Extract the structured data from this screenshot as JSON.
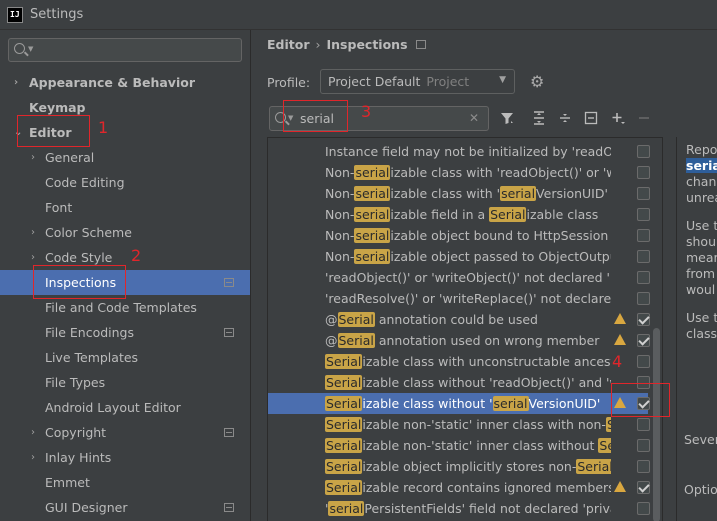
{
  "window": {
    "app_icon": "IJ",
    "title": "Settings"
  },
  "sidebar": {
    "search_placeholder": "",
    "items": [
      {
        "label": "Appearance & Behavior",
        "arrow": "›",
        "bold": true
      },
      {
        "label": "Keymap",
        "bold": true
      },
      {
        "label": "Editor",
        "arrow": "⌄",
        "bold": true
      },
      {
        "label": "General",
        "arrow": "›"
      },
      {
        "label": "Code Editing"
      },
      {
        "label": "Font"
      },
      {
        "label": "Color Scheme",
        "arrow": "›"
      },
      {
        "label": "Code Style",
        "arrow": "›"
      },
      {
        "label": "Inspections",
        "selected": true
      },
      {
        "label": "File and Code Templates"
      },
      {
        "label": "File Encodings"
      },
      {
        "label": "Live Templates"
      },
      {
        "label": "File Types"
      },
      {
        "label": "Android Layout Editor"
      },
      {
        "label": "Copyright",
        "arrow": "›"
      },
      {
        "label": "Inlay Hints",
        "arrow": "›"
      },
      {
        "label": "Emmet"
      },
      {
        "label": "GUI Designer"
      }
    ]
  },
  "breadcrumb": {
    "parent": "Editor",
    "separator": "›",
    "current": "Inspections"
  },
  "profile": {
    "label": "Profile:",
    "value": "Project Default",
    "scope": "Project"
  },
  "filter": {
    "value": "serial"
  },
  "toolbar": {
    "filter_icon": "filter-icon",
    "expand_icon": "expand-all-icon",
    "collapse_icon": "collapse-all-icon",
    "reset_icon": "reset-icon",
    "add_icon": "add-icon",
    "remove_icon": "remove-icon"
  },
  "inspections": [
    {
      "parts": [
        "Instance field may not be initialized by 'readObje"
      ],
      "warn": false,
      "checked": false
    },
    {
      "parts": [
        "Non-",
        "serial",
        "izable class with 'readObject()' or 'writ"
      ],
      "warn": false,
      "checked": false
    },
    {
      "parts": [
        "Non-",
        "serial",
        "izable class with '",
        "serial",
        "VersionUID'"
      ],
      "warn": false,
      "checked": false
    },
    {
      "parts": [
        "Non-",
        "serial",
        "izable field in a ",
        "Serial",
        "izable class"
      ],
      "warn": false,
      "checked": false
    },
    {
      "parts": [
        "Non-",
        "serial",
        "izable object bound to HttpSession"
      ],
      "warn": false,
      "checked": false
    },
    {
      "parts": [
        "Non-",
        "serial",
        "izable object passed to ObjectOutputS"
      ],
      "warn": false,
      "checked": false
    },
    {
      "parts": [
        "'readObject()' or 'writeObject()' not declared 'priv"
      ],
      "warn": false,
      "checked": false
    },
    {
      "parts": [
        "'readResolve()' or 'writeReplace()' not declared 'p"
      ],
      "warn": false,
      "checked": false
    },
    {
      "parts": [
        "@",
        "Serial",
        " annotation could be used"
      ],
      "warn": true,
      "checked": true
    },
    {
      "parts": [
        "@",
        "Serial",
        " annotation used on wrong member"
      ],
      "warn": true,
      "checked": true
    },
    {
      "parts": [
        "",
        "Serial",
        "izable class with unconstructable ancestor"
      ],
      "warn": false,
      "checked": false
    },
    {
      "parts": [
        "",
        "Serial",
        "izable class without 'readObject()' and 'write"
      ],
      "warn": false,
      "checked": false
    },
    {
      "parts": [
        "",
        "Serial",
        "izable class without '",
        "serial",
        "VersionUID'"
      ],
      "warn": true,
      "checked": true,
      "selected": true
    },
    {
      "parts": [
        "",
        "Serial",
        "izable non-'static' inner class with non-",
        "Seria"
      ],
      "warn": false,
      "checked": false
    },
    {
      "parts": [
        "",
        "Serial",
        "izable non-'static' inner class without ",
        "Seri"
      ],
      "warn": false,
      "checked": false
    },
    {
      "parts": [
        "",
        "Serial",
        "izable object implicitly stores non-",
        "Serial",
        "izab"
      ],
      "warn": false,
      "checked": false
    },
    {
      "parts": [
        "",
        "Serial",
        "izable record contains ignored members"
      ],
      "warn": true,
      "checked": true
    },
    {
      "parts": [
        "'",
        "serial",
        "PersistentFields' field not declared 'private"
      ],
      "warn": false,
      "checked": false
    }
  ],
  "description": {
    "p1": [
      "Repo",
      "seria",
      "chang",
      "unrea"
    ],
    "p2": [
      "Use t",
      "shoul",
      "mear",
      "from",
      "woul"
    ],
    "p3": [
      "Use t",
      "classe"
    ]
  },
  "severity_label": "Severi",
  "options_label": "Optio",
  "annotations": {
    "n1": "1",
    "n2": "2",
    "n3": "3",
    "n4": "4"
  }
}
